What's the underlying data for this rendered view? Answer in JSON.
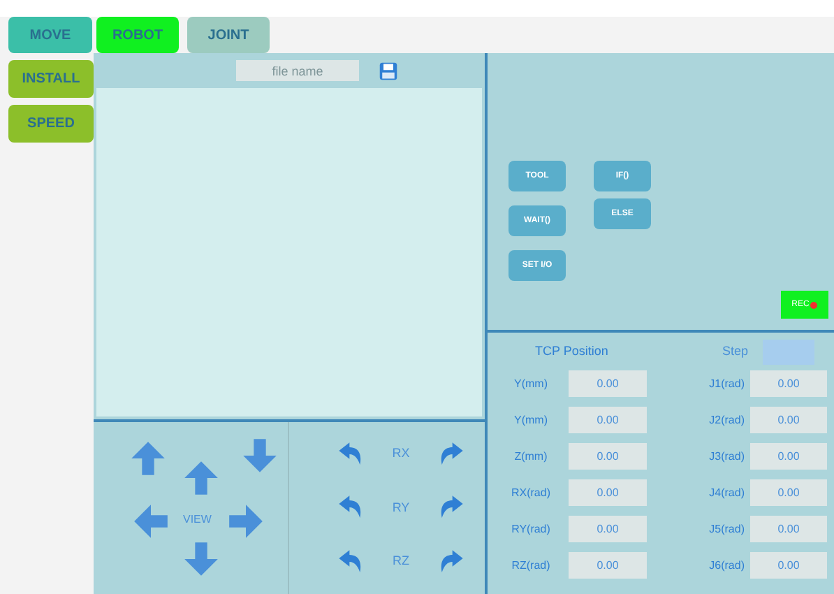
{
  "tabs": [
    {
      "label": "MOVE",
      "selected": false,
      "color": "#3bbfa8"
    },
    {
      "label": "ROBOT",
      "selected": true
    },
    {
      "label": "JOINT",
      "selected": false,
      "color": "#9ccbbf"
    }
  ],
  "side_buttons": [
    "INSTALL",
    "SPEED"
  ],
  "file": {
    "placeholder": "file name"
  },
  "view_pad": {
    "label": "VIEW"
  },
  "rotation": [
    "RX",
    "RY",
    "RZ"
  ],
  "program_buttons": [
    [
      "TOOL",
      "IF()"
    ],
    [
      "WAIT()",
      "ELSE"
    ],
    [
      "SET I/O"
    ]
  ],
  "rec": {
    "label": "REC",
    "recording": true
  },
  "tcp": {
    "title": "TCP Position",
    "step_label": "Step",
    "rows": [
      {
        "label": "Y(mm)",
        "value": "0.00"
      },
      {
        "label": "Y(mm)",
        "value": "0.00"
      },
      {
        "label": "Z(mm)",
        "value": "0.00"
      },
      {
        "label": "RX(rad)",
        "value": "0.00"
      },
      {
        "label": "RY(rad)",
        "value": "0.00"
      },
      {
        "label": "RZ(rad)",
        "value": "0.00"
      }
    ],
    "joints": [
      {
        "label": "J1(rad)",
        "value": "0.00"
      },
      {
        "label": "J2(rad)",
        "value": "0.00"
      },
      {
        "label": "J3(rad)",
        "value": "0.00"
      },
      {
        "label": "J4(rad)",
        "value": "0.00"
      },
      {
        "label": "J5(rad)",
        "value": "0.00"
      },
      {
        "label": "J6(rad)",
        "value": "0.00"
      }
    ]
  }
}
